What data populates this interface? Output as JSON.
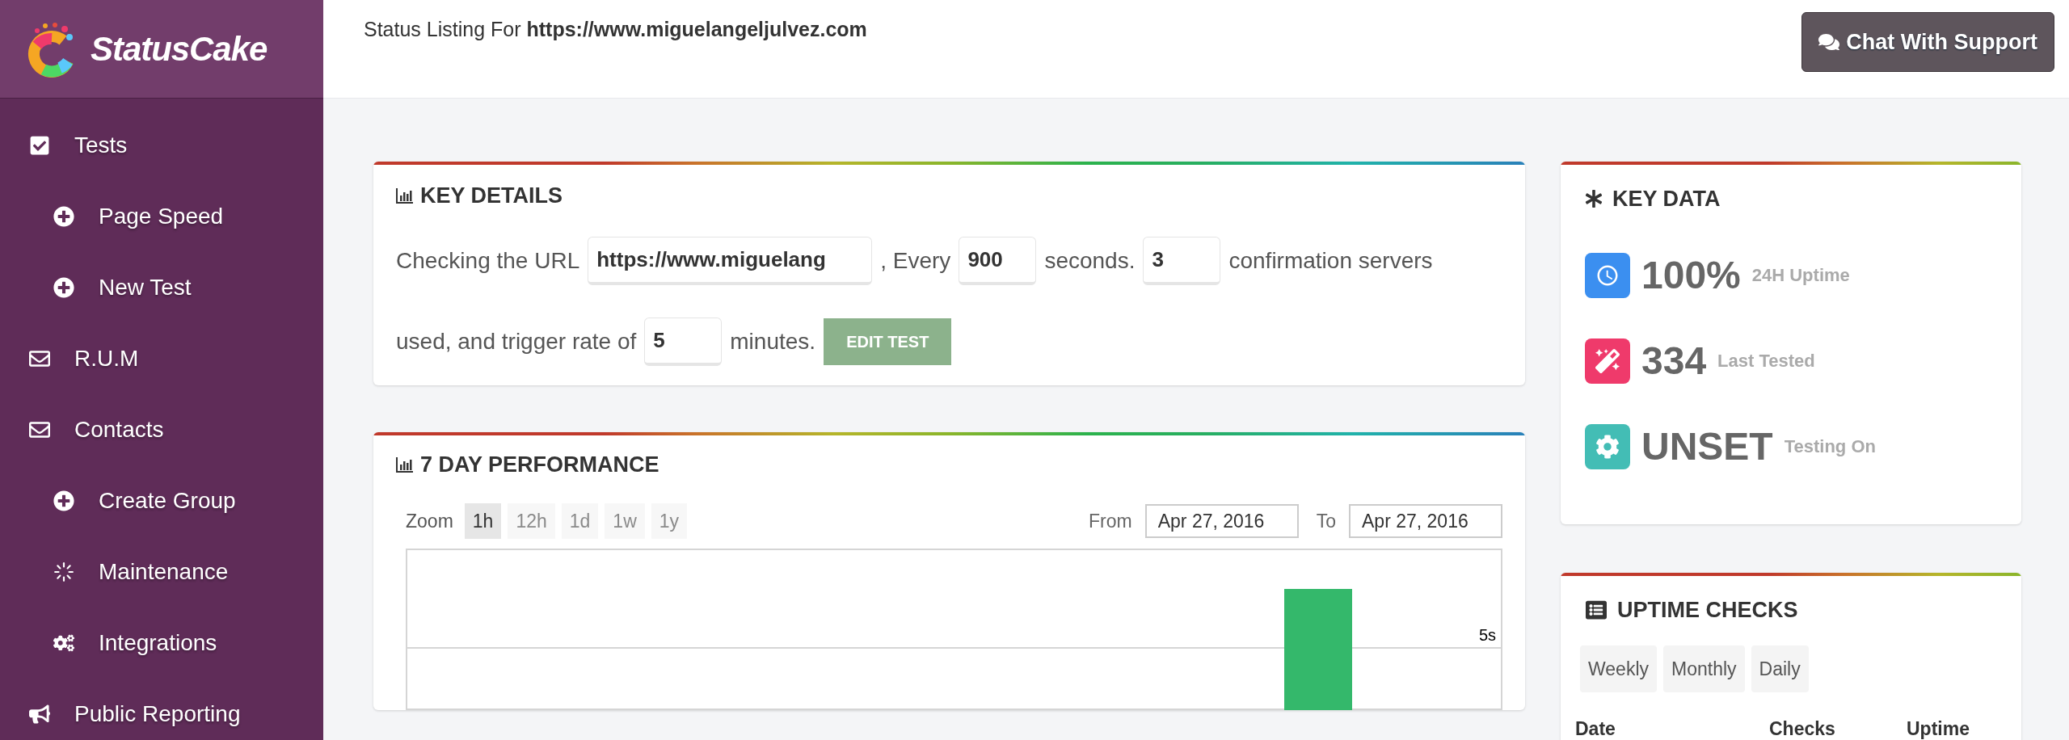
{
  "brand": "StatusCake",
  "sidebar": {
    "items": [
      {
        "label": "Tests",
        "children": [
          {
            "label": "Page Speed"
          },
          {
            "label": "New Test"
          }
        ]
      },
      {
        "label": "R.U.M"
      },
      {
        "label": "Contacts",
        "children": [
          {
            "label": "Create Group"
          },
          {
            "label": "Maintenance"
          },
          {
            "label": "Integrations"
          }
        ]
      },
      {
        "label": "Public Reporting"
      }
    ]
  },
  "header": {
    "title": "Status Listing For **https://www.miguelangeljulvez.com**",
    "chat_button": "Chat With Support"
  },
  "key_details": {
    "title": "KEY DETAILS",
    "sentence": [
      {
        "kind": "text",
        "text": "Checking the URL"
      },
      {
        "kind": "field",
        "value": "https://www.miguelang"
      },
      {
        "kind": "text",
        "text": ", Every"
      },
      {
        "kind": "field",
        "value": "900"
      },
      {
        "kind": "text",
        "text": "seconds."
      },
      {
        "kind": "field",
        "value": "3"
      },
      {
        "kind": "text",
        "text": "confirmation servers used, and trigger rate of"
      },
      {
        "kind": "field",
        "value": "5"
      },
      {
        "kind": "text",
        "text": "minutes."
      }
    ],
    "edit_button": "EDIT TEST"
  },
  "performance": {
    "title": "7 DAY PERFORMANCE",
    "zoom_label": "Zoom",
    "zoom_options": [
      {
        "label": "1h",
        "selected": true,
        "disabled": false
      },
      {
        "label": "12h",
        "selected": false,
        "disabled": true
      },
      {
        "label": "1d",
        "selected": false,
        "disabled": true
      },
      {
        "label": "1w",
        "selected": false,
        "disabled": true
      },
      {
        "label": "1y",
        "selected": false,
        "disabled": true
      }
    ],
    "from_label": "From",
    "from": "Apr 27, 2016",
    "to_label": "To",
    "to": "Apr 27, 2016",
    "gridline_label": "5s"
  },
  "key_data": {
    "title": "KEY DATA",
    "rows": [
      {
        "value": "100%",
        "label": "24H Uptime",
        "color": "#3b8ff0"
      },
      {
        "value": "334",
        "label": "Last Tested",
        "color": "#ef3a6b"
      },
      {
        "value": "UNSET",
        "label": "Testing On",
        "color": "#43bdb5"
      }
    ]
  },
  "uptime_checks": {
    "title": "UPTIME CHECKS",
    "tabs": [
      {
        "label": "Weekly"
      },
      {
        "label": "Monthly"
      },
      {
        "label": "Daily"
      }
    ],
    "columns": [
      "Date",
      "Checks",
      "Uptime"
    ]
  }
}
